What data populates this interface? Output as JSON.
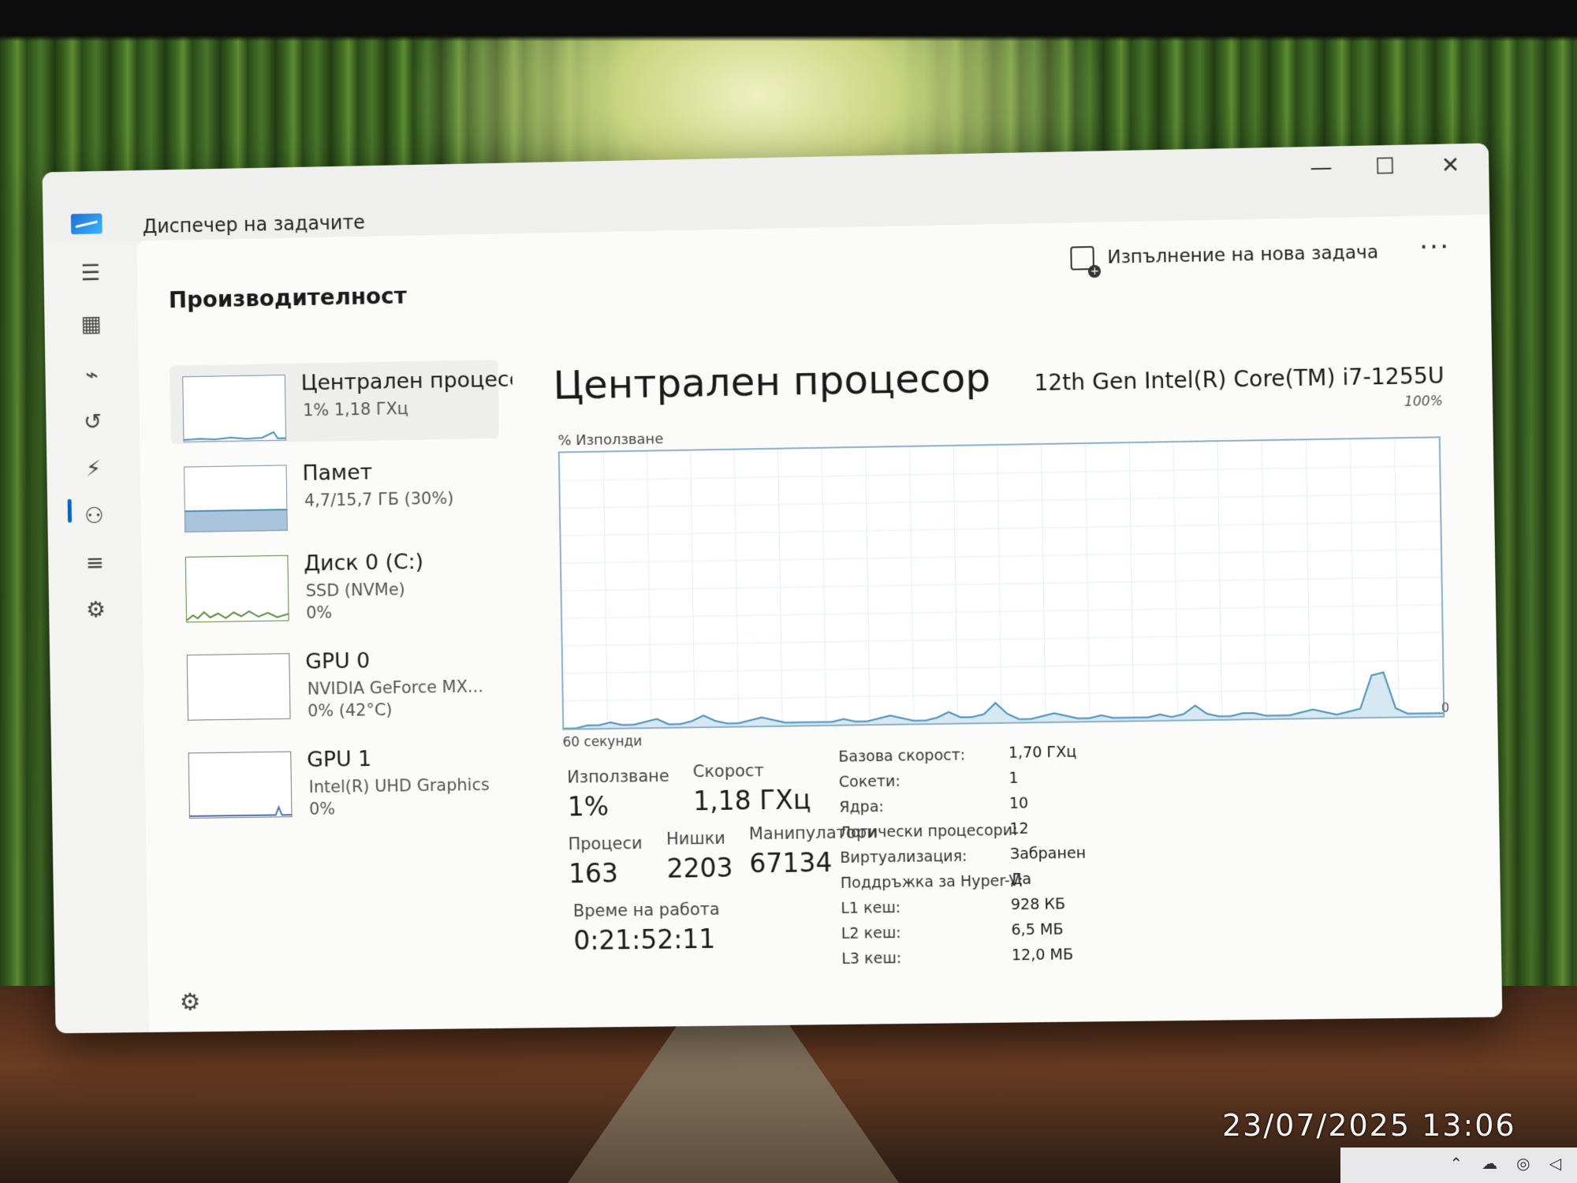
{
  "window": {
    "title": "Диспечер на задачите",
    "minimize": "—",
    "maximize": "☐",
    "close": "✕"
  },
  "header": {
    "title": "Производителност",
    "run_new_task": "Изпълнение на нова задача",
    "more": "···"
  },
  "nav": {
    "items": [
      {
        "name": "menu-icon",
        "glyph": "☰"
      },
      {
        "name": "processes-icon",
        "glyph": "▦"
      },
      {
        "name": "performance-icon",
        "glyph": "⌁"
      },
      {
        "name": "app-history-icon",
        "glyph": "↺"
      },
      {
        "name": "startup-apps-icon",
        "glyph": "⚡"
      },
      {
        "name": "users-icon",
        "glyph": "⚇"
      },
      {
        "name": "details-icon",
        "glyph": "≡"
      },
      {
        "name": "services-icon",
        "glyph": "⚙"
      }
    ],
    "settings": "⚙"
  },
  "resources": [
    {
      "name": "Централен процесор",
      "sub1": "1%  1,18 ГХц",
      "sub2": ""
    },
    {
      "name": "Памет",
      "sub1": "4,7/15,7 ГБ (30%)",
      "sub2": ""
    },
    {
      "name": "Диск 0 (C:)",
      "sub1": "SSD (NVMe)",
      "sub2": "0%"
    },
    {
      "name": "GPU 0",
      "sub1": "NVIDIA GeForce MX...",
      "sub2": "0% (42°C)"
    },
    {
      "name": "GPU 1",
      "sub1": "Intel(R) UHD Graphics",
      "sub2": "0%"
    }
  ],
  "detail": {
    "title": "Централен процесор",
    "model": "12th Gen Intel(R) Core(TM) i7-1255U",
    "graph_label": "% Използване",
    "graph_max": "100%",
    "graph_min": "0",
    "graph_time": "60 секунди",
    "stats": {
      "usage_label": "Използване",
      "usage": "1%",
      "speed_label": "Скорост",
      "speed": "1,18 ГХц",
      "processes_label": "Процеси",
      "processes": "163",
      "threads_label": "Нишки",
      "threads": "2203",
      "handles_label": "Манипулатори",
      "handles": "67134",
      "uptime_label": "Време на работа",
      "uptime": "0:21:52:11"
    },
    "specs": [
      {
        "label": "Базова скорост:",
        "value": "1,70 ГХц"
      },
      {
        "label": "Сокети:",
        "value": "1"
      },
      {
        "label": "Ядра:",
        "value": "10"
      },
      {
        "label": "Логически процесори:",
        "value": "12"
      },
      {
        "label": "Виртуализация:",
        "value": "Забранен"
      },
      {
        "label": "Поддръжка за Hyper-V:",
        "value": "Да"
      },
      {
        "label": "L1 кеш:",
        "value": "928 КБ"
      },
      {
        "label": "L2 кеш:",
        "value": "6,5 МБ"
      },
      {
        "label": "L3 кеш:",
        "value": "12,0 МБ"
      }
    ]
  },
  "cpu_history_percent": [
    0,
    0,
    1,
    1,
    2,
    1,
    1,
    2,
    3,
    1,
    1,
    2,
    4,
    2,
    1,
    1,
    2,
    3,
    2,
    1,
    1,
    1,
    1,
    1,
    2,
    1,
    1,
    2,
    3,
    2,
    1,
    1,
    2,
    4,
    2,
    2,
    3,
    7,
    3,
    1,
    1,
    2,
    3,
    2,
    1,
    1,
    2,
    1,
    1,
    1,
    1,
    2,
    1,
    2,
    5,
    2,
    1,
    1,
    2,
    2,
    1,
    1,
    1,
    2,
    3,
    2,
    1,
    2,
    3,
    15,
    16,
    3,
    1,
    1,
    1,
    1
  ],
  "colors": {
    "graph_line": "#4a8fb5",
    "graph_fill": "#d6e8f2",
    "graph_grid": "#e4eef4",
    "accent": "#0067c0"
  },
  "photo_overlay": {
    "timestamp": "23/07/2025  13:06"
  }
}
